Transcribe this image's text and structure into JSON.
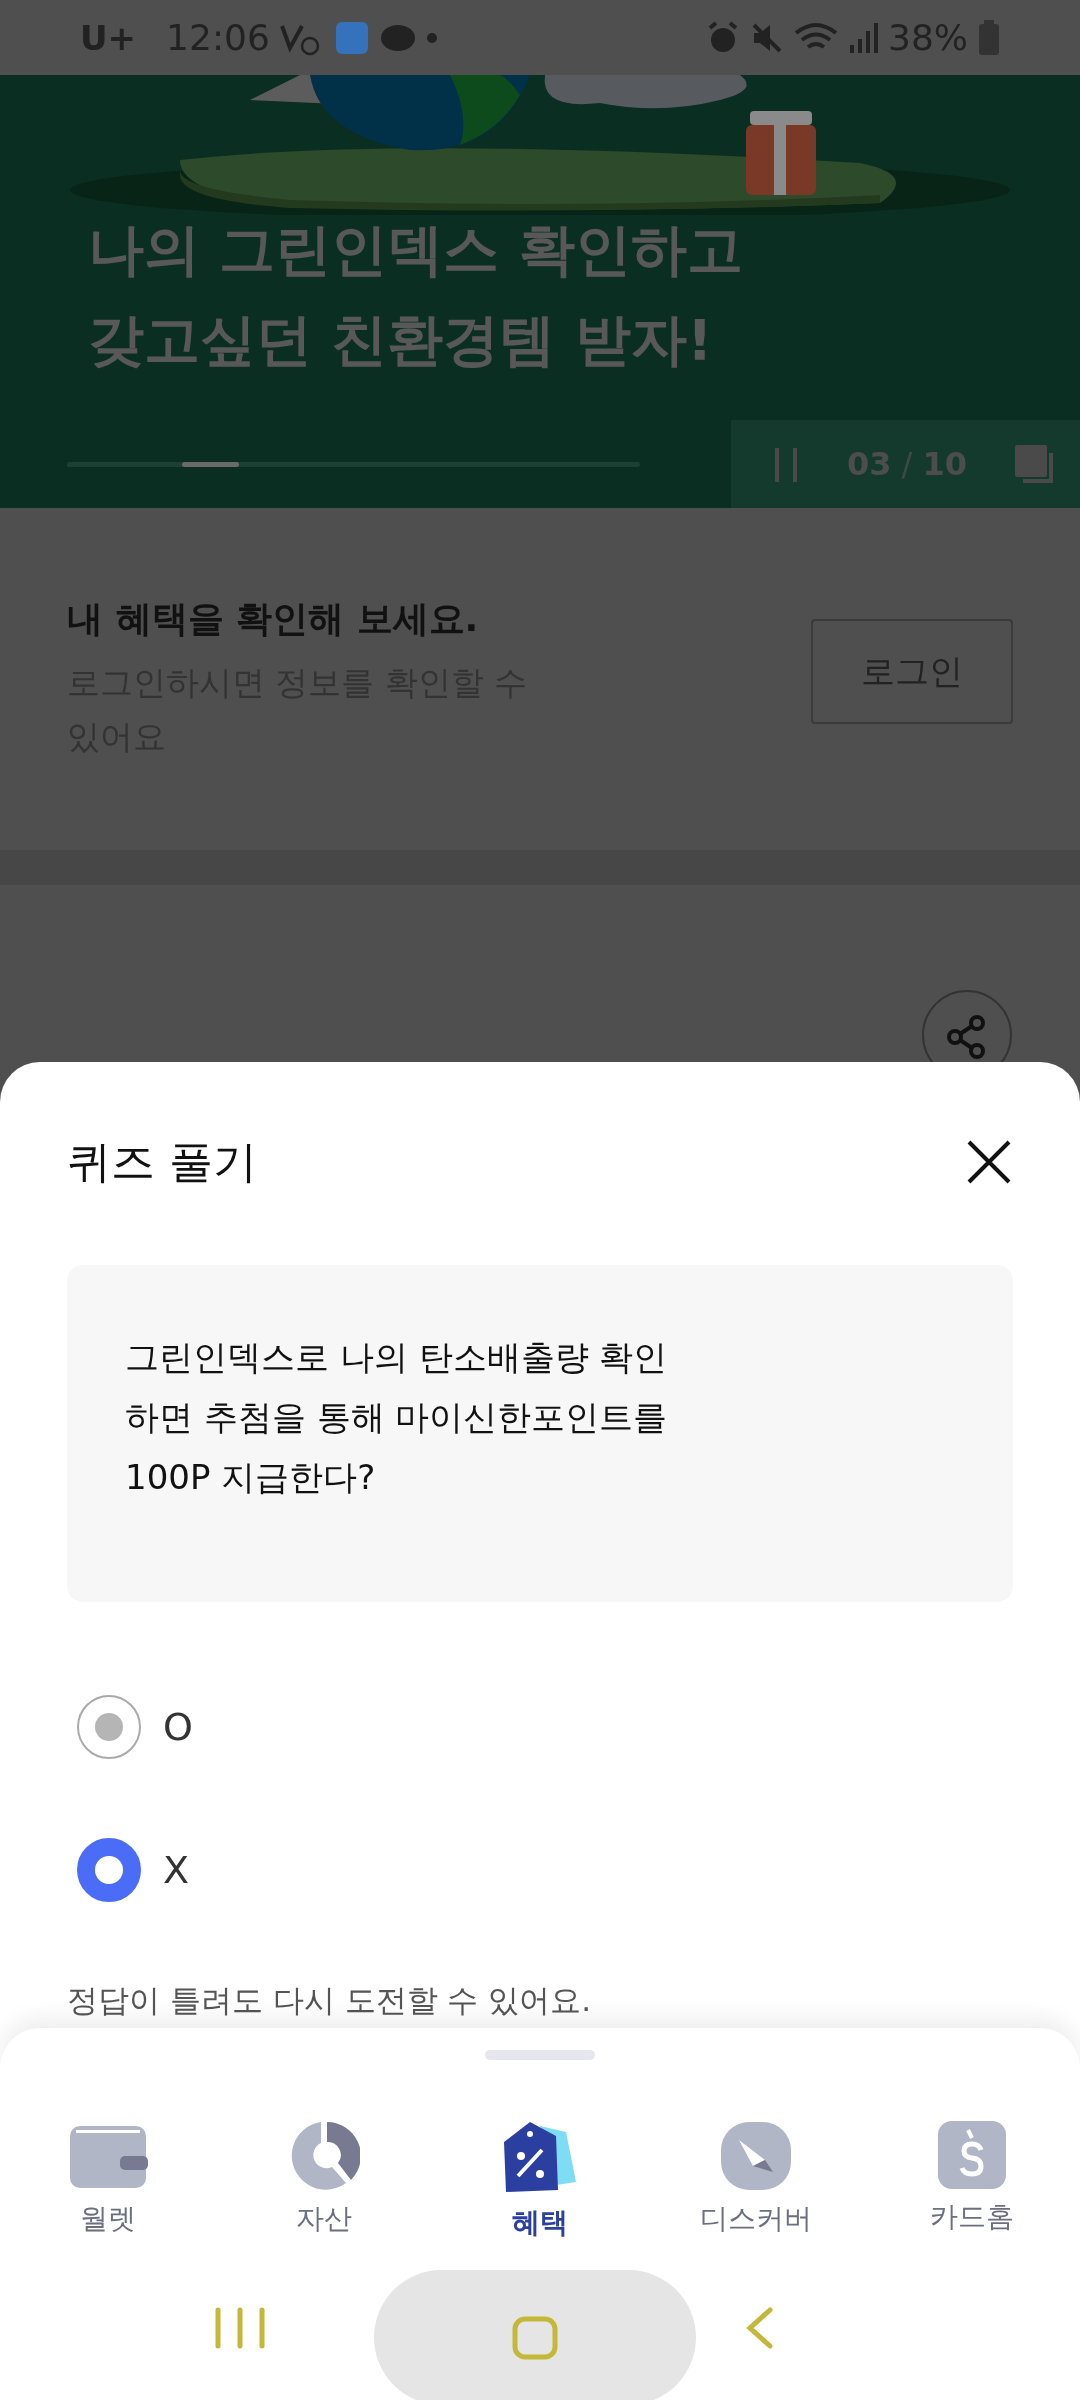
{
  "status_bar": {
    "carrier": "U+",
    "time": "12:06",
    "battery": "38%"
  },
  "banner": {
    "title_lines": [
      "나의 그린인덱스 확인하고",
      "갖고싶던 친환경템 받자!"
    ],
    "counter": {
      "current": "03",
      "separator": "/",
      "total": "10"
    }
  },
  "login_prompt": {
    "title": "내 혜택을 확인해 보세요.",
    "description_lines": [
      "로그인하시면 정보를 확인할 수",
      "있어요"
    ],
    "button": "로그인"
  },
  "quiz_sheet": {
    "title": "퀴즈 풀기",
    "question_lines": [
      "그린인덱스로 나의 탄소배출량 확인",
      "하면 추첨을 통해 마이신한포인트를",
      "100P 지급한다?"
    ],
    "options": [
      {
        "label": "O",
        "selected": false
      },
      {
        "label": "X",
        "selected": true
      }
    ],
    "hint": "정답이 틀려도 다시 도전할 수 있어요."
  },
  "bottom_nav": [
    {
      "kind": "wallet",
      "label": "월렛",
      "selected": false
    },
    {
      "kind": "assets",
      "label": "자산",
      "selected": false
    },
    {
      "kind": "benefits",
      "label": "혜택",
      "selected": true
    },
    {
      "kind": "discover",
      "label": "디스커버",
      "selected": false
    },
    {
      "kind": "card",
      "label": "카드홈",
      "selected": false
    }
  ]
}
